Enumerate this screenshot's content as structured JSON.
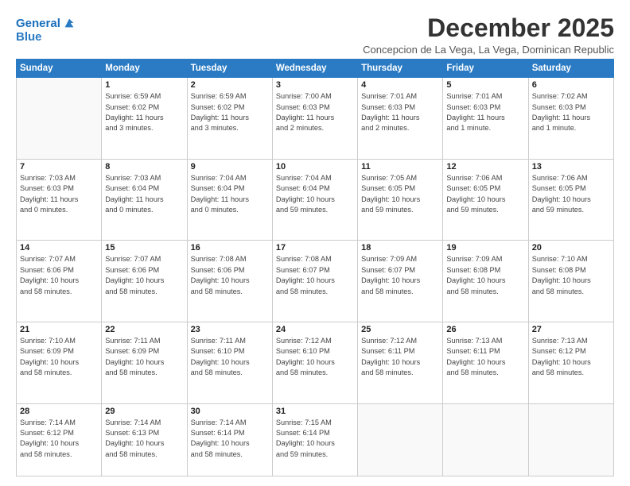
{
  "header": {
    "logo_line1": "General",
    "logo_line2": "Blue",
    "month_title": "December 2025",
    "subtitle": "Concepcion de La Vega, La Vega, Dominican Republic"
  },
  "days_of_week": [
    "Sunday",
    "Monday",
    "Tuesday",
    "Wednesday",
    "Thursday",
    "Friday",
    "Saturday"
  ],
  "weeks": [
    [
      {
        "day": "",
        "info": ""
      },
      {
        "day": "1",
        "info": "Sunrise: 6:59 AM\nSunset: 6:02 PM\nDaylight: 11 hours\nand 3 minutes."
      },
      {
        "day": "2",
        "info": "Sunrise: 6:59 AM\nSunset: 6:02 PM\nDaylight: 11 hours\nand 3 minutes."
      },
      {
        "day": "3",
        "info": "Sunrise: 7:00 AM\nSunset: 6:03 PM\nDaylight: 11 hours\nand 2 minutes."
      },
      {
        "day": "4",
        "info": "Sunrise: 7:01 AM\nSunset: 6:03 PM\nDaylight: 11 hours\nand 2 minutes."
      },
      {
        "day": "5",
        "info": "Sunrise: 7:01 AM\nSunset: 6:03 PM\nDaylight: 11 hours\nand 1 minute."
      },
      {
        "day": "6",
        "info": "Sunrise: 7:02 AM\nSunset: 6:03 PM\nDaylight: 11 hours\nand 1 minute."
      }
    ],
    [
      {
        "day": "7",
        "info": "Sunrise: 7:03 AM\nSunset: 6:03 PM\nDaylight: 11 hours\nand 0 minutes."
      },
      {
        "day": "8",
        "info": "Sunrise: 7:03 AM\nSunset: 6:04 PM\nDaylight: 11 hours\nand 0 minutes."
      },
      {
        "day": "9",
        "info": "Sunrise: 7:04 AM\nSunset: 6:04 PM\nDaylight: 11 hours\nand 0 minutes."
      },
      {
        "day": "10",
        "info": "Sunrise: 7:04 AM\nSunset: 6:04 PM\nDaylight: 10 hours\nand 59 minutes."
      },
      {
        "day": "11",
        "info": "Sunrise: 7:05 AM\nSunset: 6:05 PM\nDaylight: 10 hours\nand 59 minutes."
      },
      {
        "day": "12",
        "info": "Sunrise: 7:06 AM\nSunset: 6:05 PM\nDaylight: 10 hours\nand 59 minutes."
      },
      {
        "day": "13",
        "info": "Sunrise: 7:06 AM\nSunset: 6:05 PM\nDaylight: 10 hours\nand 59 minutes."
      }
    ],
    [
      {
        "day": "14",
        "info": "Sunrise: 7:07 AM\nSunset: 6:06 PM\nDaylight: 10 hours\nand 58 minutes."
      },
      {
        "day": "15",
        "info": "Sunrise: 7:07 AM\nSunset: 6:06 PM\nDaylight: 10 hours\nand 58 minutes."
      },
      {
        "day": "16",
        "info": "Sunrise: 7:08 AM\nSunset: 6:06 PM\nDaylight: 10 hours\nand 58 minutes."
      },
      {
        "day": "17",
        "info": "Sunrise: 7:08 AM\nSunset: 6:07 PM\nDaylight: 10 hours\nand 58 minutes."
      },
      {
        "day": "18",
        "info": "Sunrise: 7:09 AM\nSunset: 6:07 PM\nDaylight: 10 hours\nand 58 minutes."
      },
      {
        "day": "19",
        "info": "Sunrise: 7:09 AM\nSunset: 6:08 PM\nDaylight: 10 hours\nand 58 minutes."
      },
      {
        "day": "20",
        "info": "Sunrise: 7:10 AM\nSunset: 6:08 PM\nDaylight: 10 hours\nand 58 minutes."
      }
    ],
    [
      {
        "day": "21",
        "info": "Sunrise: 7:10 AM\nSunset: 6:09 PM\nDaylight: 10 hours\nand 58 minutes."
      },
      {
        "day": "22",
        "info": "Sunrise: 7:11 AM\nSunset: 6:09 PM\nDaylight: 10 hours\nand 58 minutes."
      },
      {
        "day": "23",
        "info": "Sunrise: 7:11 AM\nSunset: 6:10 PM\nDaylight: 10 hours\nand 58 minutes."
      },
      {
        "day": "24",
        "info": "Sunrise: 7:12 AM\nSunset: 6:10 PM\nDaylight: 10 hours\nand 58 minutes."
      },
      {
        "day": "25",
        "info": "Sunrise: 7:12 AM\nSunset: 6:11 PM\nDaylight: 10 hours\nand 58 minutes."
      },
      {
        "day": "26",
        "info": "Sunrise: 7:13 AM\nSunset: 6:11 PM\nDaylight: 10 hours\nand 58 minutes."
      },
      {
        "day": "27",
        "info": "Sunrise: 7:13 AM\nSunset: 6:12 PM\nDaylight: 10 hours\nand 58 minutes."
      }
    ],
    [
      {
        "day": "28",
        "info": "Sunrise: 7:14 AM\nSunset: 6:12 PM\nDaylight: 10 hours\nand 58 minutes."
      },
      {
        "day": "29",
        "info": "Sunrise: 7:14 AM\nSunset: 6:13 PM\nDaylight: 10 hours\nand 58 minutes."
      },
      {
        "day": "30",
        "info": "Sunrise: 7:14 AM\nSunset: 6:14 PM\nDaylight: 10 hours\nand 58 minutes."
      },
      {
        "day": "31",
        "info": "Sunrise: 7:15 AM\nSunset: 6:14 PM\nDaylight: 10 hours\nand 59 minutes."
      },
      {
        "day": "",
        "info": ""
      },
      {
        "day": "",
        "info": ""
      },
      {
        "day": "",
        "info": ""
      }
    ]
  ]
}
